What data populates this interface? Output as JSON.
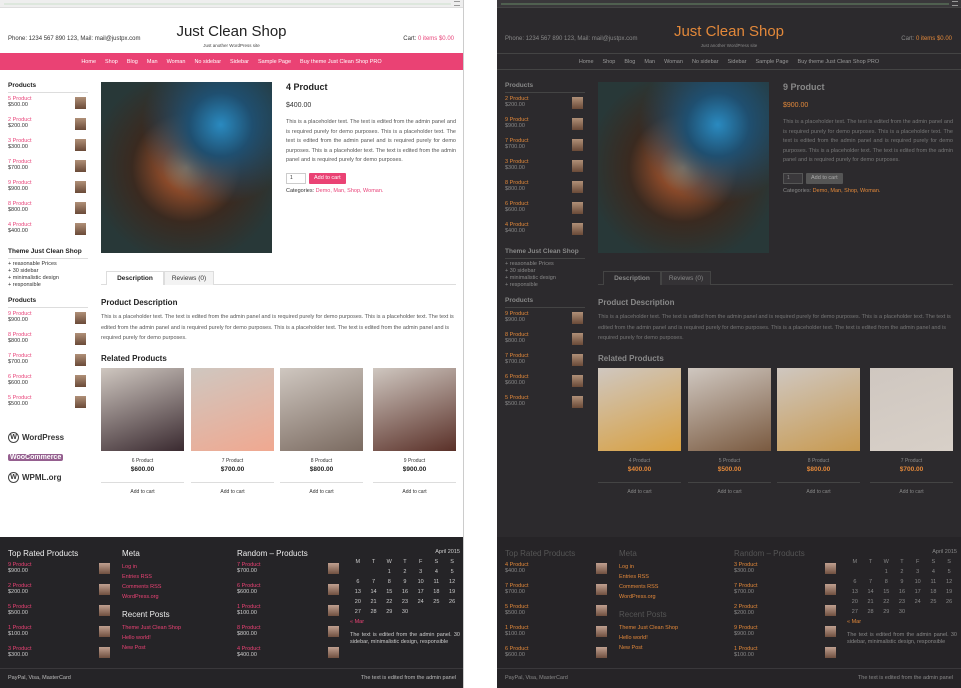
{
  "site": {
    "phone": "Phone: 1234 567 890 123, Mail: mail@justpx.com",
    "title": "Just Clean Shop",
    "tagline": "Just another WordPress site",
    "cart_label": "Cart:",
    "cart_value": "0 items $0.00"
  },
  "nav": [
    "Home",
    "Shop",
    "Blog",
    "Man",
    "Woman",
    "No sidebar",
    "Sidebar",
    "Sample Page",
    "Buy theme Just Clean Shop PRO"
  ],
  "sidebar": {
    "products_heading": "Products",
    "theme_heading": "Theme Just Clean Shop",
    "theme_items": [
      "+ reasonable Prices",
      "+ 30 sidebar",
      "+ minimalistic design",
      "+ responsible"
    ],
    "products2_heading": "Products"
  },
  "light": {
    "sidebar_products": [
      {
        "name": "5 Product",
        "price": "$500.00"
      },
      {
        "name": "2 Product",
        "price": "$200.00"
      },
      {
        "name": "3 Product",
        "price": "$300.00"
      },
      {
        "name": "7 Product",
        "price": "$700.00"
      },
      {
        "name": "9 Product",
        "price": "$900.00"
      },
      {
        "name": "8 Product",
        "price": "$800.00"
      },
      {
        "name": "4 Product",
        "price": "$400.00"
      }
    ],
    "sidebar_products2": [
      {
        "name": "9 Product",
        "price": "$900.00"
      },
      {
        "name": "8 Product",
        "price": "$800.00"
      },
      {
        "name": "7 Product",
        "price": "$700.00"
      },
      {
        "name": "6 Product",
        "price": "$600.00"
      },
      {
        "name": "5 Product",
        "price": "$500.00"
      }
    ],
    "logos": [
      "WordPress",
      "WooCommerce",
      "WPML.org"
    ],
    "product": {
      "title": "4 Product",
      "price": "$400.00",
      "qty": "1",
      "categories": "Demo, Man, Shop, Woman."
    },
    "related": [
      {
        "name": "6 Product",
        "price": "$600.00"
      },
      {
        "name": "7 Product",
        "price": "$700.00"
      },
      {
        "name": "8 Product",
        "price": "$800.00"
      },
      {
        "name": "9 Product",
        "price": "$900.00"
      }
    ],
    "top_rated": [
      {
        "name": "9 Product",
        "price": "$900.00"
      },
      {
        "name": "2 Product",
        "price": "$200.00"
      },
      {
        "name": "5 Product",
        "price": "$500.00"
      },
      {
        "name": "1 Product",
        "price": "$100.00"
      },
      {
        "name": "3 Product",
        "price": "$300.00"
      }
    ],
    "random": [
      {
        "name": "7 Product",
        "price": "$700.00"
      },
      {
        "name": "6 Product",
        "price": "$600.00"
      },
      {
        "name": "1 Product",
        "price": "$100.00"
      },
      {
        "name": "8 Product",
        "price": "$800.00"
      },
      {
        "name": "4 Product",
        "price": "$400.00"
      }
    ]
  },
  "dark": {
    "sidebar_products": [
      {
        "name": "2 Product",
        "price": "$200.00"
      },
      {
        "name": "9 Product",
        "price": "$900.00"
      },
      {
        "name": "7 Product",
        "price": "$700.00"
      },
      {
        "name": "3 Product",
        "price": "$300.00"
      },
      {
        "name": "8 Product",
        "price": "$800.00"
      },
      {
        "name": "6 Product",
        "price": "$600.00"
      },
      {
        "name": "4 Product",
        "price": "$400.00"
      }
    ],
    "sidebar_products2": [
      {
        "name": "9 Product",
        "price": "$900.00"
      },
      {
        "name": "8 Product",
        "price": "$800.00"
      },
      {
        "name": "7 Product",
        "price": "$700.00"
      },
      {
        "name": "6 Product",
        "price": "$600.00"
      },
      {
        "name": "5 Product",
        "price": "$500.00"
      }
    ],
    "product": {
      "title": "9 Product",
      "price": "$900.00",
      "qty": "1",
      "categories": "Demo, Man, Shop, Woman."
    },
    "related": [
      {
        "name": "4 Product",
        "price": "$400.00"
      },
      {
        "name": "5 Product",
        "price": "$500.00"
      },
      {
        "name": "8 Product",
        "price": "$800.00"
      },
      {
        "name": "7 Product",
        "price": "$700.00"
      }
    ],
    "top_rated": [
      {
        "name": "4 Product",
        "price": "$400.00"
      },
      {
        "name": "7 Product",
        "price": "$700.00"
      },
      {
        "name": "5 Product",
        "price": "$500.00"
      },
      {
        "name": "1 Product",
        "price": "$100.00"
      },
      {
        "name": "6 Product",
        "price": "$600.00"
      }
    ],
    "random": [
      {
        "name": "3 Product",
        "price": "$300.00"
      },
      {
        "name": "7 Product",
        "price": "$700.00"
      },
      {
        "name": "2 Product",
        "price": "$200.00"
      },
      {
        "name": "9 Product",
        "price": "$900.00"
      },
      {
        "name": "1 Product",
        "price": "$100.00"
      }
    ]
  },
  "product_common": {
    "short_desc": "This is a placeholder text. The text is edited from the admin panel and is required purely for demo purposes. This is a placeholder text. The text is edited from the admin panel and is required purely for demo purposes. This is a placeholder text. The text is edited from the admin panel and is required purely for demo purposes.",
    "add_to_cart": "Add to cart",
    "categories_label": "Categories:",
    "tab_description": "Description",
    "tab_reviews": "Reviews (0)",
    "desc_heading": "Product Description",
    "desc_text": "This is a placeholder text. The text is edited from the admin panel and is required purely for demo purposes. This is a placeholder text. The text is edited from the admin panel and is required purely for demo purposes. This is a placeholder text. The text is edited from the admin panel and is required purely for demo purposes.",
    "related_heading": "Related Products",
    "related_button": "Add to cart"
  },
  "footer": {
    "top_rated_heading": "Top Rated Products",
    "meta_heading": "Meta",
    "meta_links": [
      "Log in",
      "Entries RSS",
      "Comments RSS",
      "WordPress.org"
    ],
    "recent_heading": "Recent Posts",
    "recent_links": [
      "Theme Just Clean Shop",
      "Hello world!",
      "New Post"
    ],
    "random_heading": "Random – Products",
    "calendar_caption": "April 2015",
    "calendar_days": [
      "M",
      "T",
      "W",
      "T",
      "F",
      "S",
      "S"
    ],
    "calendar_rows": [
      [
        "",
        "",
        "1",
        "2",
        "3",
        "4",
        "5"
      ],
      [
        "6",
        "7",
        "8",
        "9",
        "10",
        "11",
        "12"
      ],
      [
        "13",
        "14",
        "15",
        "16",
        "17",
        "18",
        "19"
      ],
      [
        "20",
        "21",
        "22",
        "23",
        "24",
        "25",
        "26"
      ],
      [
        "27",
        "28",
        "29",
        "30",
        "",
        "",
        ""
      ]
    ],
    "calendar_prev": "« Mar",
    "calendar_text": "The text is edited from the admin panel. 30 sidebar, minimalistic design, responsible",
    "bottom_left": "PayPal, Visa, MasterCard",
    "bottom_right": "The text is edited from the admin panel"
  }
}
